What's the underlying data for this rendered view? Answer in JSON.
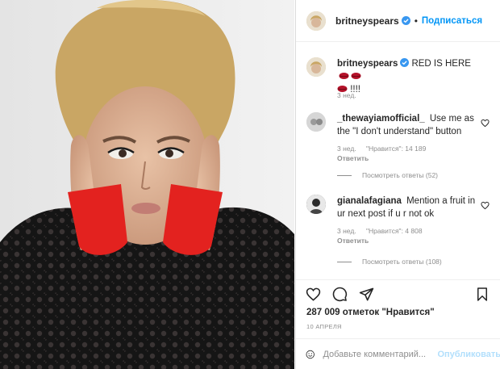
{
  "post": {
    "username": "britneyspears",
    "follow_label": "Подписаться",
    "caption_text": "RED IS HERE",
    "caption_tail": "!!!!",
    "caption_time": "3 нед."
  },
  "comments": [
    {
      "username": "_thewayiamofficial_",
      "text": "Use me as the \"I don't understand\" button",
      "time": "3 нед.",
      "likes": "\"Нравится\": 14 189",
      "reply_label": "Ответить",
      "view_replies": "Посмотреть ответы (52)"
    },
    {
      "username": "gianalafagiana",
      "text": "Mention a fruit in ur next post if u r not ok",
      "time": "3 нед.",
      "likes": "\"Нравится\": 4 808",
      "reply_label": "Ответить",
      "view_replies": "Посмотреть ответы (108)"
    }
  ],
  "stats": {
    "likes": "287 009 отметок \"Нравится\"",
    "date": "10 АПРЕЛЯ"
  },
  "comment_box": {
    "placeholder": "Добавьте комментарий...",
    "publish_label": "Опубликовать"
  },
  "icons": {
    "verified": "verified-badge-icon",
    "like": "heart-icon",
    "comment": "speech-bubble-icon",
    "share": "paper-plane-icon",
    "save": "bookmark-icon",
    "emoji": "smiley-icon",
    "lips": "lips-emoji-icon"
  },
  "colors": {
    "accent": "#0095f6",
    "muted": "#8e8e8e",
    "publish_disabled": "#b2dffc"
  }
}
